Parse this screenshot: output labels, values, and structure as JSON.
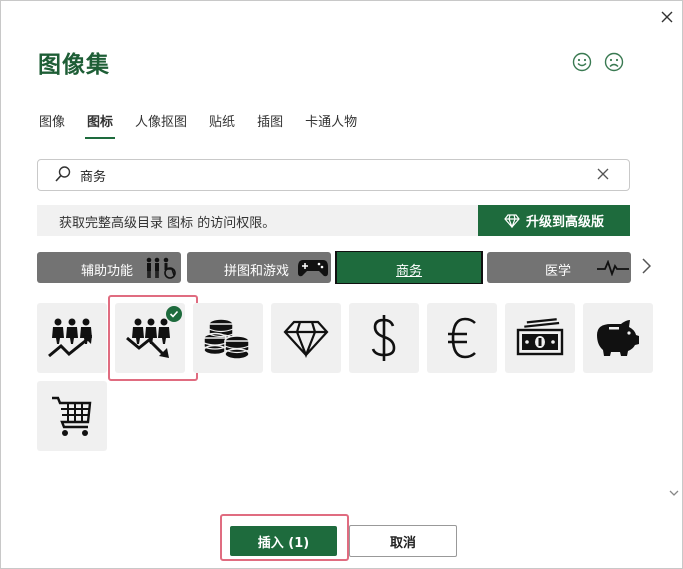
{
  "dialog": {
    "title": "图像集",
    "close_icon": "close-icon",
    "feedback": {
      "happy_icon": "smile-icon",
      "sad_icon": "frown-icon"
    }
  },
  "tabs": [
    {
      "label": "图像",
      "active": false
    },
    {
      "label": "图标",
      "active": true
    },
    {
      "label": "人像抠图",
      "active": false
    },
    {
      "label": "贴纸",
      "active": false
    },
    {
      "label": "插图",
      "active": false
    },
    {
      "label": "卡通人物",
      "active": false
    }
  ],
  "search": {
    "value": "商务",
    "placeholder": "",
    "icon": "search-icon",
    "clear_icon": "clear-icon"
  },
  "banner": {
    "text": "获取完整高级目录 图标 的访问权限。",
    "upgrade_label": "升级到高级版",
    "upgrade_icon": "diamond-icon"
  },
  "categories": [
    {
      "label": "辅助功能",
      "icon": "accessibility-icon",
      "selected": false
    },
    {
      "label": "拼图和游戏",
      "icon": "gamepad-icon",
      "selected": false
    },
    {
      "label": "商务",
      "icon": "",
      "selected": true
    },
    {
      "label": "医学",
      "icon": "heartbeat-icon",
      "selected": false
    }
  ],
  "icons": [
    {
      "name": "business-growth-icon",
      "selected": false
    },
    {
      "name": "business-decline-icon",
      "selected": true
    },
    {
      "name": "coins-icon",
      "selected": false
    },
    {
      "name": "diamond-icon",
      "selected": false
    },
    {
      "name": "dollar-icon",
      "selected": false
    },
    {
      "name": "euro-icon",
      "selected": false
    },
    {
      "name": "money-icon",
      "selected": false
    },
    {
      "name": "piggy-bank-icon",
      "selected": false
    },
    {
      "name": "shopping-cart-icon",
      "selected": false
    }
  ],
  "buttons": {
    "insert_label": "插入 (1)",
    "cancel_label": "取消"
  },
  "colors": {
    "accent": "#1e6b3d",
    "selection_frame": "#e06c80",
    "category_bg": "#737373",
    "tile_bg": "#f0f0f0"
  }
}
